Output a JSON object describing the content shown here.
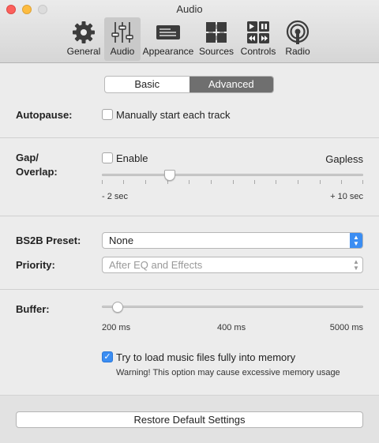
{
  "window": {
    "title": "Audio"
  },
  "toolbar": {
    "items": [
      {
        "label": "General",
        "icon": "gear-icon"
      },
      {
        "label": "Audio",
        "icon": "sliders-icon"
      },
      {
        "label": "Appearance",
        "icon": "display-icon"
      },
      {
        "label": "Sources",
        "icon": "puzzle-icon"
      },
      {
        "label": "Controls",
        "icon": "playback-controls-icon"
      },
      {
        "label": "Radio",
        "icon": "radio-broadcast-icon"
      }
    ],
    "selected": "Audio"
  },
  "tabs": {
    "items": [
      "Basic",
      "Advanced"
    ],
    "selected": "Advanced"
  },
  "autopause": {
    "label": "Autopause:",
    "checkbox_label": "Manually start each track",
    "checked": false
  },
  "gap": {
    "label_line1": "Gap/",
    "label_line2": "Overlap:",
    "enable_label": "Enable",
    "enabled": false,
    "value_label": "Gapless",
    "min_label": "- 2 sec",
    "max_label": "+ 10 sec",
    "slider_value_fraction": 0.26
  },
  "bs2b": {
    "label": "BS2B Preset:",
    "value": "None"
  },
  "priority": {
    "label": "Priority:",
    "value": "After EQ and Effects"
  },
  "buffer": {
    "label": "Buffer:",
    "ticks": [
      "200 ms",
      "400 ms",
      "5000 ms"
    ],
    "slider_value_fraction": 0.06,
    "memory_label": "Try to load music files fully into memory",
    "memory_checked": true,
    "warning": "Warning! This option may cause excessive memory usage"
  },
  "footer": {
    "restore_label": "Restore Default Settings"
  },
  "colors": {
    "accent": "#3b8df2",
    "selected_tab": "#6f6f6f",
    "close": "#fc605c",
    "minimize": "#fdbc40"
  }
}
